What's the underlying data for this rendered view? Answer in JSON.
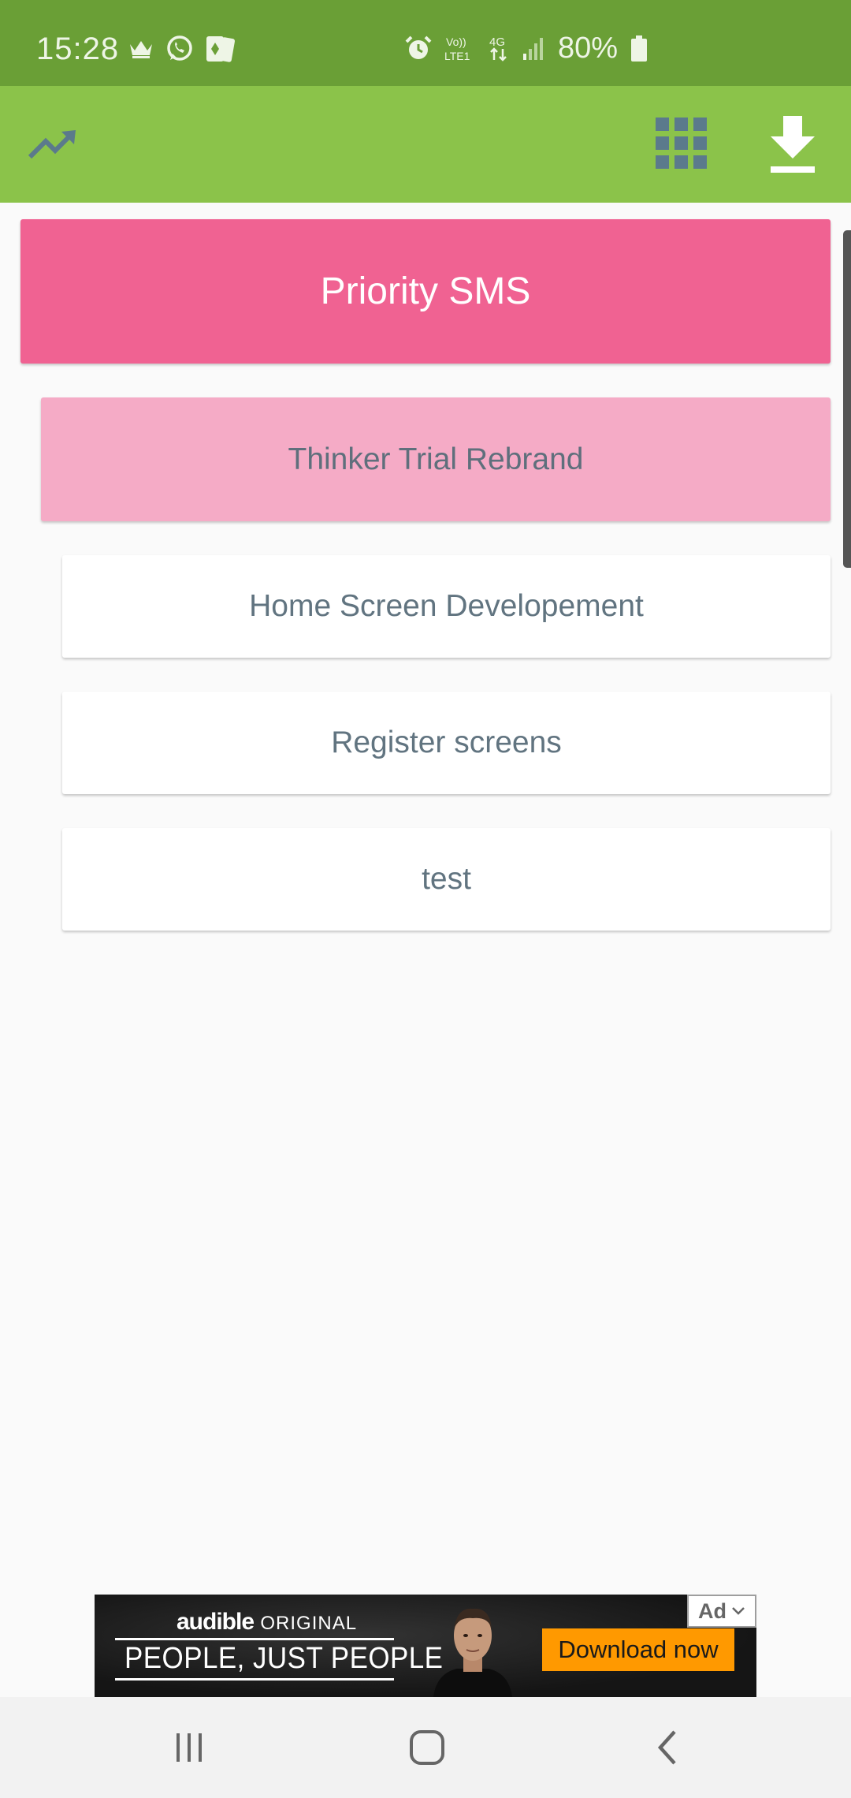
{
  "status_bar": {
    "time": "15:28",
    "battery": "80%",
    "left_icons": [
      "crown-icon",
      "whatsapp-icon",
      "cards-icon"
    ],
    "right_icons": [
      "alarm-icon",
      "volte-icon",
      "4g-icon",
      "signal-icon",
      "battery-icon"
    ],
    "volte_label": "Vo)) LTE1",
    "network_label": "4G"
  },
  "app_bar": {
    "left_icon": "trending-up-icon",
    "right_icons": [
      "apps-grid-icon",
      "download-icon"
    ]
  },
  "cards": {
    "project": "Priority SMS",
    "subproject": "Thinker Trial Rebrand",
    "tasks": [
      "Home Screen Developement",
      "Register screens",
      "test"
    ]
  },
  "ad": {
    "brand": "audible",
    "brand_sub": "ORIGINAL",
    "headline": "PEOPLE, JUST PEOPLE",
    "cta": "Download now",
    "badge": "Ad"
  },
  "colors": {
    "status_bar": "#6a9f36",
    "app_bar": "#8bc34a",
    "project_card": "#f06292",
    "subproject_card": "#f5abc6",
    "task_text": "#617480",
    "cta": "#ff9900"
  }
}
